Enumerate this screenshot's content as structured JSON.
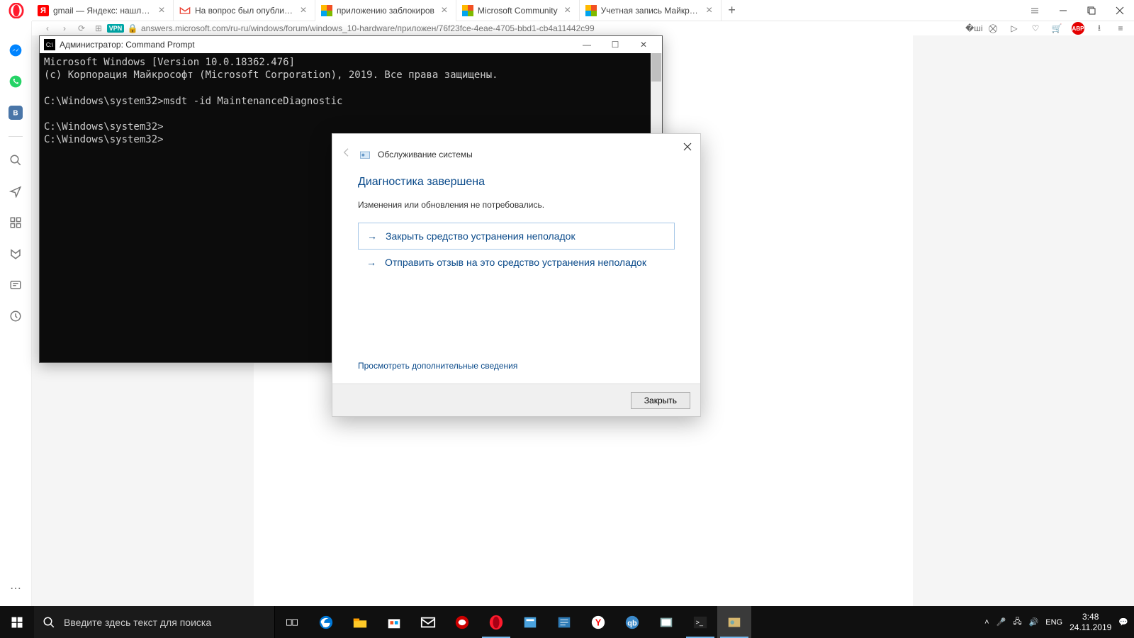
{
  "browser": {
    "tabs": [
      {
        "title": "gmail — Яндекс: нашлось",
        "favicon": "Я"
      },
      {
        "title": "На вопрос был опубликов",
        "favicon": "M"
      },
      {
        "title": "приложению заблокиров",
        "favicon": "ms",
        "active": true
      },
      {
        "title": "Microsoft Community",
        "favicon": "ms"
      },
      {
        "title": "Учетная запись Майкросо",
        "favicon": "ms"
      }
    ],
    "url": "answers.microsoft.com/ru-ru/windows/forum/windows_10-hardware/приложен/76f23fce-4eae-4705-bbd1-cb4a11442c99",
    "vpn": "VPN"
  },
  "cmd": {
    "title": "Администратор: Command Prompt",
    "lines": [
      "Microsoft Windows [Version 10.0.18362.476]",
      "(c) Корпорация Майкрософт (Microsoft Corporation), 2019. Все права защищены.",
      "",
      "C:\\Windows\\system32>msdt -id MaintenanceDiagnostic",
      "",
      "C:\\Windows\\system32>",
      "C:\\Windows\\system32>"
    ]
  },
  "dialog": {
    "header": "Обслуживание системы",
    "title": "Диагностика завершена",
    "subtitle": "Изменения или обновления не потребовались.",
    "option_close": "Закрыть средство устранения неполадок",
    "option_feedback": "Отправить отзыв на это средство устранения неполадок",
    "link_more": "Просмотреть дополнительные сведения",
    "btn_close": "Закрыть"
  },
  "taskbar": {
    "search_placeholder": "Введите здесь текст для поиска",
    "lang": "ENG",
    "time": "3:48",
    "date": "24.11.2019"
  }
}
